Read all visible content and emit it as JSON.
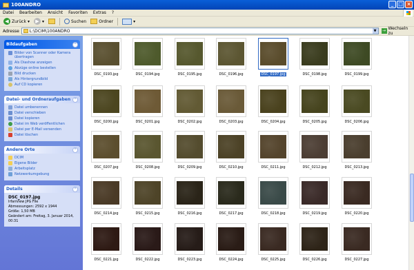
{
  "window": {
    "title": "100ANDRO"
  },
  "menu": [
    "Datei",
    "Bearbeiten",
    "Ansicht",
    "Favoriten",
    "Extras",
    "?"
  ],
  "toolbar": {
    "back": "Zurück",
    "search": "Suchen",
    "folders": "Ordner"
  },
  "address": {
    "label": "Adresse",
    "path": "L:\\DCIM\\100ANDRO",
    "go": "Wechseln zu"
  },
  "tasks": {
    "title": "Bildaufgaben",
    "items": [
      "Bilder von Scanner oder Kamera übertragen",
      "Als Diashow anzeigen",
      "Abzüge online bestellen",
      "Bild drucken",
      "Als Hintergrundbild",
      "Auf CD kopieren"
    ]
  },
  "file_tasks": {
    "title": "Datei- und Ordneraufgaben",
    "items": [
      "Datei umbenennen",
      "Datei verschieben",
      "Datei kopieren",
      "Datei im Web veröffentlichen",
      "Datei per E-Mail versenden",
      "Datei löschen"
    ]
  },
  "places": {
    "title": "Andere Orte",
    "items": [
      "DCIM",
      "Eigene Bilder",
      "Arbeitsplatz",
      "Netzwerkumgebung"
    ]
  },
  "details": {
    "title": "Details",
    "filename": "DSC_0197.jpg",
    "type": "IrfanView JPG File",
    "dims": "Abmessungen: 2592 x 1944",
    "size": "Größe: 1,50 MB",
    "modified": "Geändert am: Freitag, 3. Januar 2014, 00:31"
  },
  "files": [
    {
      "name": "DSC_0193.jpg",
      "color": "#5a5030"
    },
    {
      "name": "DSC_0194.jpg",
      "color": "#4e5a2c"
    },
    {
      "name": "DSC_0195.jpg",
      "color": "#56582e"
    },
    {
      "name": "DSC_0196.jpg",
      "color": "#5c5632"
    },
    {
      "name": "DSC_0197.jpg",
      "color": "#5a4c2c",
      "selected": true
    },
    {
      "name": "DSC_0198.jpg",
      "color": "#3a3c1e"
    },
    {
      "name": "DSC_0199.jpg",
      "color": "#3e4a24"
    },
    {
      "name": "DSC_0200.jpg",
      "color": "#4c4620"
    },
    {
      "name": "DSC_0201.jpg",
      "color": "#6e5a36"
    },
    {
      "name": "DSC_0202.jpg",
      "color": "#625a34"
    },
    {
      "name": "DSC_0203.jpg",
      "color": "#6a5a38"
    },
    {
      "name": "DSC_0204.jpg",
      "color": "#4a421e"
    },
    {
      "name": "DSC_0205.jpg",
      "color": "#46441e"
    },
    {
      "name": "DSC_0206.jpg",
      "color": "#4a4a22"
    },
    {
      "name": "DSC_0207.jpg",
      "color": "#5c4e2e"
    },
    {
      "name": "DSC_0208.jpg",
      "color": "#5a5630"
    },
    {
      "name": "DSC_0209.jpg",
      "color": "#544c2e"
    },
    {
      "name": "DSC_0210.jpg",
      "color": "#4c4226"
    },
    {
      "name": "DSC_0211.jpg",
      "color": "#54442c"
    },
    {
      "name": "DSC_0212.jpg",
      "color": "#4c3e34"
    },
    {
      "name": "DSC_0213.jpg",
      "color": "#4a3e2e"
    },
    {
      "name": "DSC_0214.jpg",
      "color": "#4a3a26"
    },
    {
      "name": "DSC_0215.jpg",
      "color": "#4e4428"
    },
    {
      "name": "DSC_0216.jpg",
      "color": "#2a2418"
    },
    {
      "name": "DSC_0217.jpg",
      "color": "#2a2a1c"
    },
    {
      "name": "DSC_0218.jpg",
      "color": "#3a4a48"
    },
    {
      "name": "DSC_0219.jpg",
      "color": "#3a2a28"
    },
    {
      "name": "DSC_0220.jpg",
      "color": "#3a2a22"
    },
    {
      "name": "DSC_0221.jpg",
      "color": "#2e1a14"
    },
    {
      "name": "DSC_0222.jpg",
      "color": "#2a1a18"
    },
    {
      "name": "DSC_0223.jpg",
      "color": "#261c18"
    },
    {
      "name": "DSC_0224.jpg",
      "color": "#2a1c16"
    },
    {
      "name": "DSC_0225.jpg",
      "color": "#3a2a22"
    },
    {
      "name": "DSC_0226.jpg",
      "color": "#2e2418"
    },
    {
      "name": "DSC_0227.jpg",
      "color": "#3a2a22"
    }
  ]
}
